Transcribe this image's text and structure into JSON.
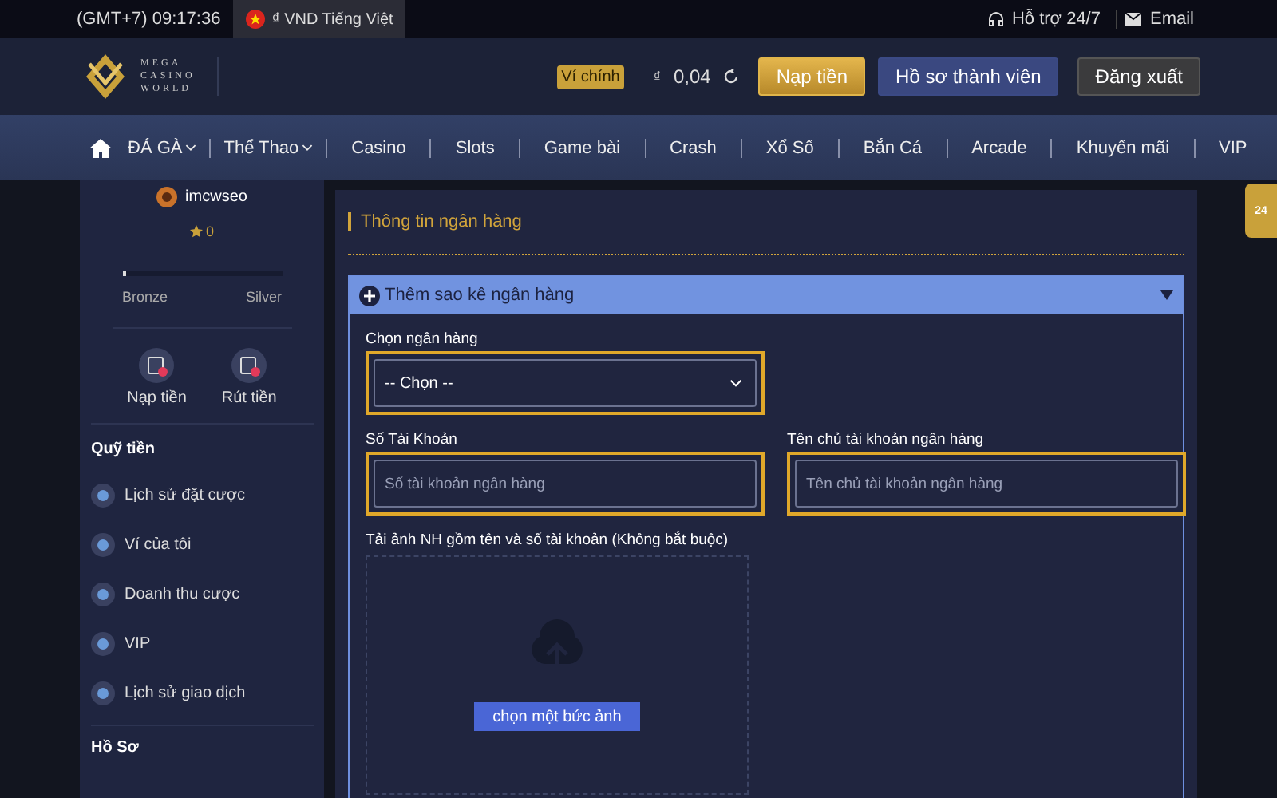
{
  "top_bar": {
    "time": "(GMT+7) 09:17:36",
    "currency_language": "₫ VND Tiếng Việt",
    "support": "Hỗ trợ 24/7",
    "email": "Email"
  },
  "header": {
    "logo_lines": [
      "MEGA",
      "CASINO",
      "WORLD"
    ],
    "wallet_label": "Ví chính",
    "currency": "₫",
    "balance": "0,04",
    "buttons": [
      {
        "label": "Nạp tiền",
        "kind": "gold"
      },
      {
        "label": "Hồ sơ thành viên",
        "kind": "blue"
      },
      {
        "label": "Đăng xuất",
        "kind": "dark"
      }
    ]
  },
  "nav": [
    {
      "label": "ĐÁ GÀ",
      "dropdown": true
    },
    {
      "label": "Thể Thao",
      "dropdown": true
    },
    {
      "label": "Casino",
      "dropdown": false
    },
    {
      "label": "Slots",
      "dropdown": false
    },
    {
      "label": "Game bài",
      "dropdown": false
    },
    {
      "label": "Crash",
      "dropdown": false
    },
    {
      "label": "Xổ Số",
      "dropdown": false
    },
    {
      "label": "Bắn Cá",
      "dropdown": false
    },
    {
      "label": "Arcade",
      "dropdown": false
    },
    {
      "label": "Khuyến mãi",
      "dropdown": false
    },
    {
      "label": "VIP",
      "dropdown": false
    }
  ],
  "sidebar": {
    "username": "imcwseo",
    "stars": "0",
    "progress": {
      "level": 0.02,
      "from": "Bronze",
      "to": "Silver"
    },
    "actions": [
      "Nạp tiền",
      "Rút tiền"
    ],
    "sections": [
      {
        "title": "Quỹ tiền",
        "items": [
          "Lịch sử đặt cược",
          "Ví của tôi",
          "Doanh thu cược",
          "VIP",
          "Lịch sử giao dịch"
        ]
      },
      {
        "title": "Hồ Sơ"
      }
    ]
  },
  "panel": {
    "title": "Thông tin ngân hàng",
    "accordion": {
      "title": "Thêm sao kê ngân hàng",
      "expanded": true,
      "bank_select": {
        "label": "Chọn ngân hàng",
        "value": "-- Chọn --"
      },
      "account_number": {
        "label": "Số Tài Khoản",
        "placeholder": "Số tài khoản ngân hàng"
      },
      "account_name": {
        "label": "Tên chủ tài khoản ngân hàng",
        "placeholder": "Tên chủ tài khoản ngân hàng"
      },
      "upload": {
        "label": "Tải ảnh NH gồm tên và số tài khoản (Không bắt buộc)",
        "button": "chọn một bức ảnh"
      }
    }
  },
  "support_badge": "24"
}
